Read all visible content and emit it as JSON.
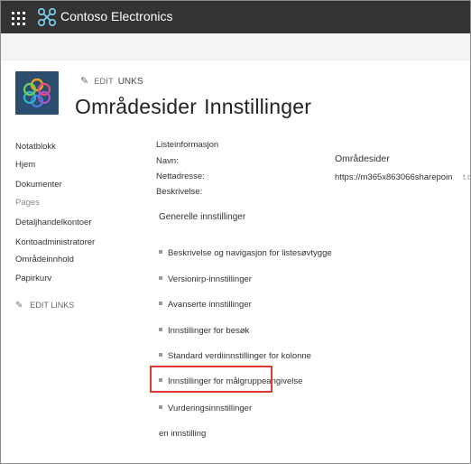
{
  "suitebar": {
    "brand_name": "Contoso Electronics",
    "waffle_icon": "app-launcher-icon",
    "brand_icon": "contoso-logo-icon",
    "background": "#333333"
  },
  "header": {
    "edit_links_prefix": "EDIT",
    "edit_links_suffix": "UNKS",
    "title_part1": "Områdesider",
    "title_part2": "Innstillinger"
  },
  "leftnav": {
    "items": [
      {
        "label": "Notatblokk",
        "muted": false
      },
      {
        "label": "Hjem",
        "muted": false
      },
      {
        "label": "Dokumenter",
        "muted": false
      },
      {
        "label": "Pages",
        "muted": true
      },
      {
        "label": "Detaljhandelkontoer",
        "muted": false
      },
      {
        "label": "Kontoadministratorer",
        "muted": false
      },
      {
        "label": "Områdeinnhold",
        "muted": false
      },
      {
        "label": "Papirkurv",
        "muted": false
      }
    ],
    "edit_links": "EDIT LINKS"
  },
  "list_info": {
    "heading": "Listeinformasjon",
    "name_label": "Navn:",
    "name_value": "Områdesider",
    "url_label": "Nettadresse:",
    "url_value": "https://m365x863066sharepoin",
    "url_tail": "t.co",
    "description_label": "Beskrivelse:"
  },
  "general_settings": {
    "heading": "Generelle innstillinger",
    "links": [
      "Beskrivelse og navigasjon for listesøvtygge",
      "Versionirp-innstillinger",
      "Avanserte innstillinger",
      "Innstillinger for besøk",
      "Standard verdiinnstillinger for kolonne",
      "Innstillinger for målgruppeangivelse",
      "Vurderingsinnstillinger"
    ],
    "extra_link": "en innstilling"
  },
  "colors": {
    "highlight": "#e03c31",
    "logo_bg": "#2b4e6e"
  }
}
